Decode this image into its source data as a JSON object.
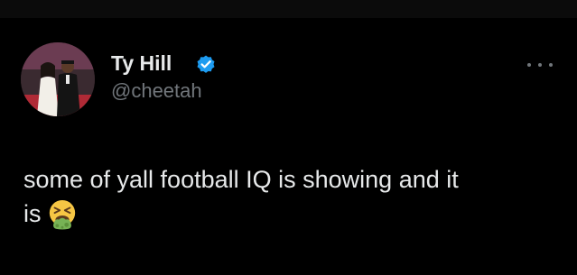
{
  "tweet": {
    "author": {
      "display_name": "Ty Hill",
      "handle": "@cheetah",
      "verified": true,
      "avatar_icon": "profile-photo"
    },
    "text_line1": "some of yall football IQ is showing and it",
    "text_line2": "is",
    "emoji_icon": "vomiting-face-emoji",
    "more_icon": "more-horizontal-icon"
  },
  "colors": {
    "background": "#000000",
    "text_primary": "#e7e9ea",
    "text_secondary": "#71767b",
    "verified_badge": "#1d9bf0"
  }
}
